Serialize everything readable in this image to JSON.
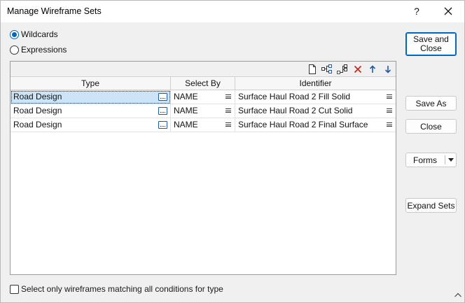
{
  "window": {
    "title": "Manage Wireframe Sets",
    "help_label": "?"
  },
  "mode": {
    "options": [
      {
        "label": "Wildcards",
        "selected": true
      },
      {
        "label": "Expressions",
        "selected": false
      }
    ]
  },
  "grid": {
    "toolbar_icons": [
      "new-page-icon",
      "tree-icon",
      "tree-insert-icon",
      "delete-icon",
      "move-up-icon",
      "move-down-icon"
    ],
    "columns": [
      "Type",
      "Select By",
      "Identifier"
    ],
    "rows": [
      {
        "type": "Road Design",
        "select_by": "NAME",
        "identifier": "Surface Haul Road 2 Fill Solid"
      },
      {
        "type": "Road Design",
        "select_by": "NAME",
        "identifier": "Surface Haul Road 2 Cut Solid"
      },
      {
        "type": "Road Design",
        "select_by": "NAME",
        "identifier": "Surface Haul Road 2 Final Surface"
      }
    ]
  },
  "buttons": {
    "save_and_close_line1": "Save and",
    "save_and_close_line2": "Close",
    "save_as": "Save As",
    "close": "Close",
    "forms": "Forms",
    "expand_sets": "Expand Sets"
  },
  "footer": {
    "match_all_label": "Select only wireframes matching all conditions for type",
    "match_all_checked": false
  },
  "colors": {
    "accent": "#0067c0",
    "selection": "#cce4f7",
    "delete_red": "#c42b1c"
  }
}
